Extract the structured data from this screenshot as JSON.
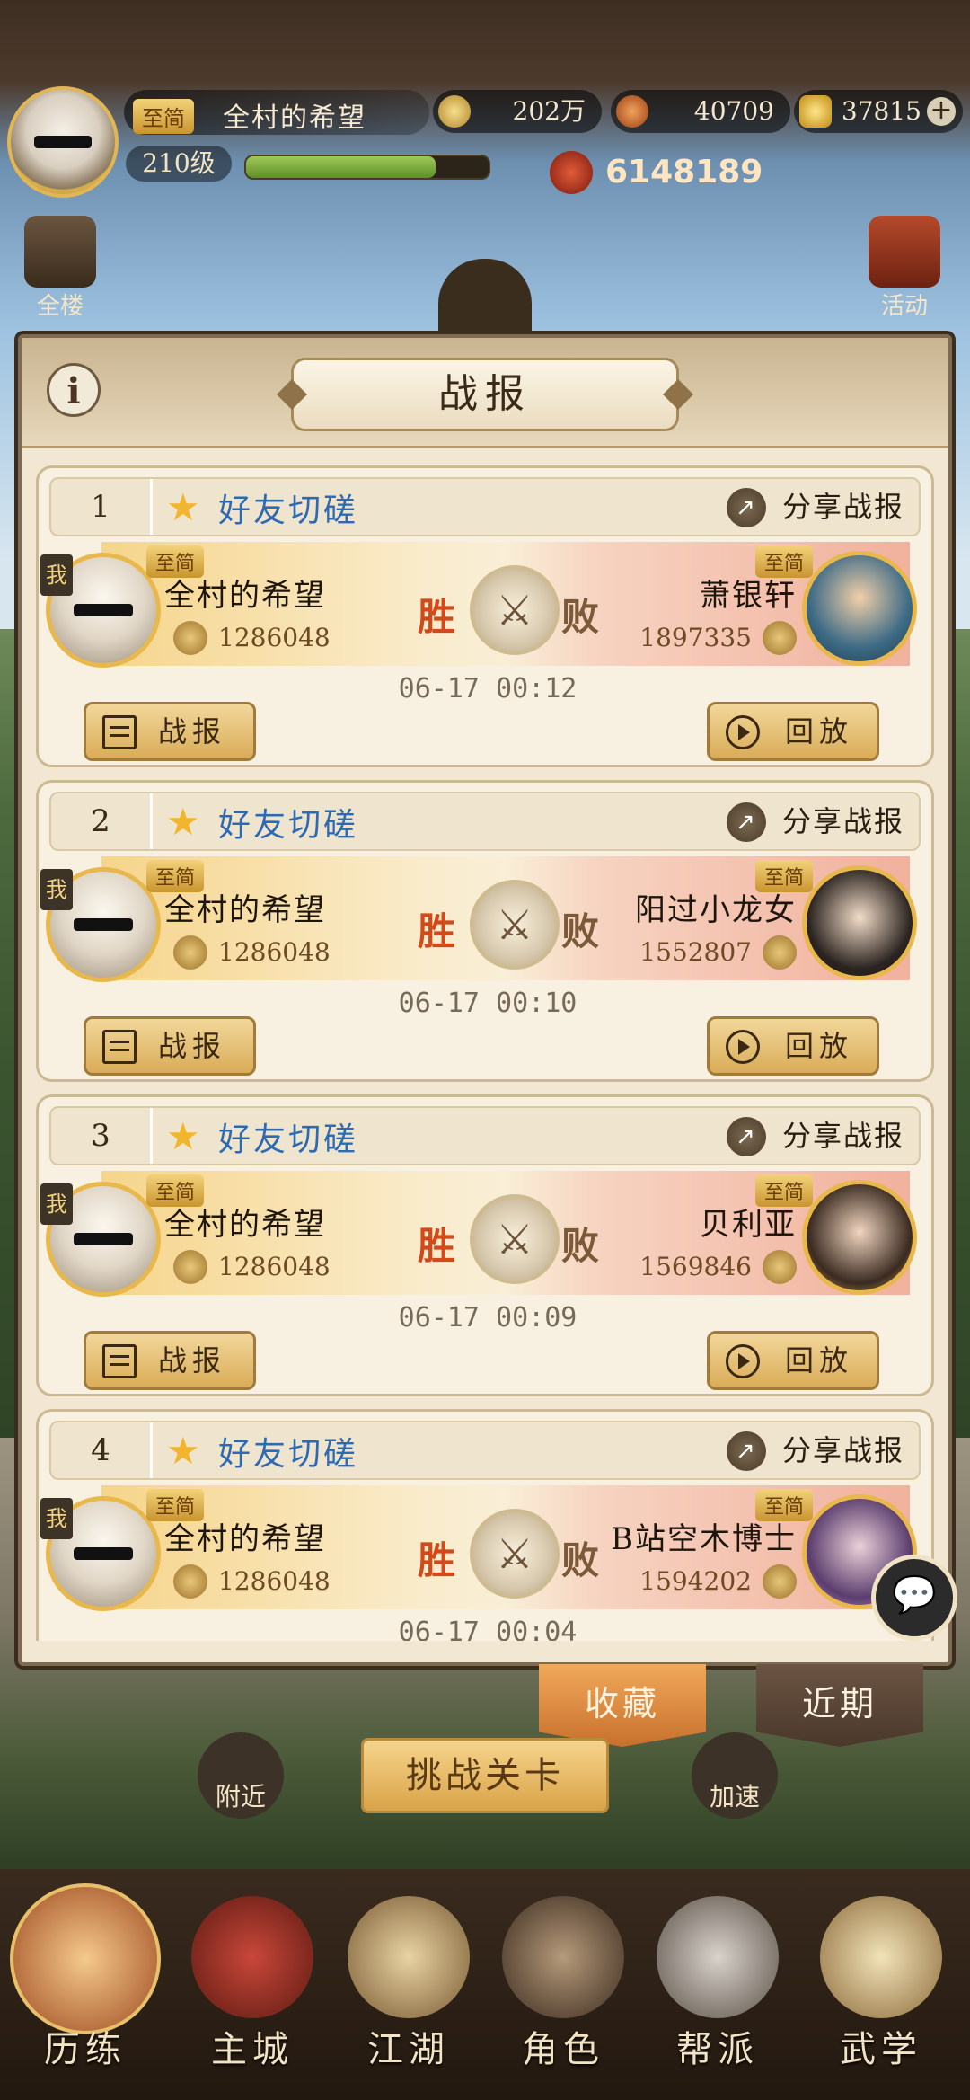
{
  "header": {
    "rank_tag": "至简",
    "player_name": "全村的希望",
    "level": "210级",
    "xp_fraction": 0.78,
    "coins": "202万",
    "leaves": "40709",
    "gold": "37815",
    "plus": "+",
    "power": "6148189",
    "left_building": "全楼",
    "right_event": "活动"
  },
  "dialog": {
    "title": "战报",
    "info": "i",
    "share_label": "分享战报",
    "report_label": "战报",
    "replay_label": "回放",
    "win_label": "胜",
    "lose_label": "败",
    "me_label": "我",
    "rank_tag": "至简",
    "records": [
      {
        "index": "1",
        "type": "好友切磋",
        "me_name": "全村的希望",
        "me_power": "1286048",
        "op_name": "萧银轩",
        "op_power": "1897335",
        "time": "06-17 00:12"
      },
      {
        "index": "2",
        "type": "好友切磋",
        "me_name": "全村的希望",
        "me_power": "1286048",
        "op_name": "阳过小龙女",
        "op_power": "1552807",
        "time": "06-17 00:10"
      },
      {
        "index": "3",
        "type": "好友切磋",
        "me_name": "全村的希望",
        "me_power": "1286048",
        "op_name": "贝利亚",
        "op_power": "1569846",
        "time": "06-17 00:09"
      },
      {
        "index": "4",
        "type": "好友切磋",
        "me_name": "全村的希望",
        "me_power": "1286048",
        "op_name": "B站空木博士",
        "op_power": "1594202",
        "time": "06-17 00:04"
      }
    ]
  },
  "tabs": {
    "favorites": "收藏",
    "recent": "近期"
  },
  "actions": {
    "nearby": "附近",
    "challenge": "挑战关卡",
    "speedup": "加速"
  },
  "nav": [
    "历练",
    "主城",
    "江湖",
    "角色",
    "帮派",
    "武学"
  ],
  "colors": {
    "accent_gold": "#d9ac58",
    "win_red": "#d24a1a",
    "type_blue": "#2e6ab1"
  }
}
